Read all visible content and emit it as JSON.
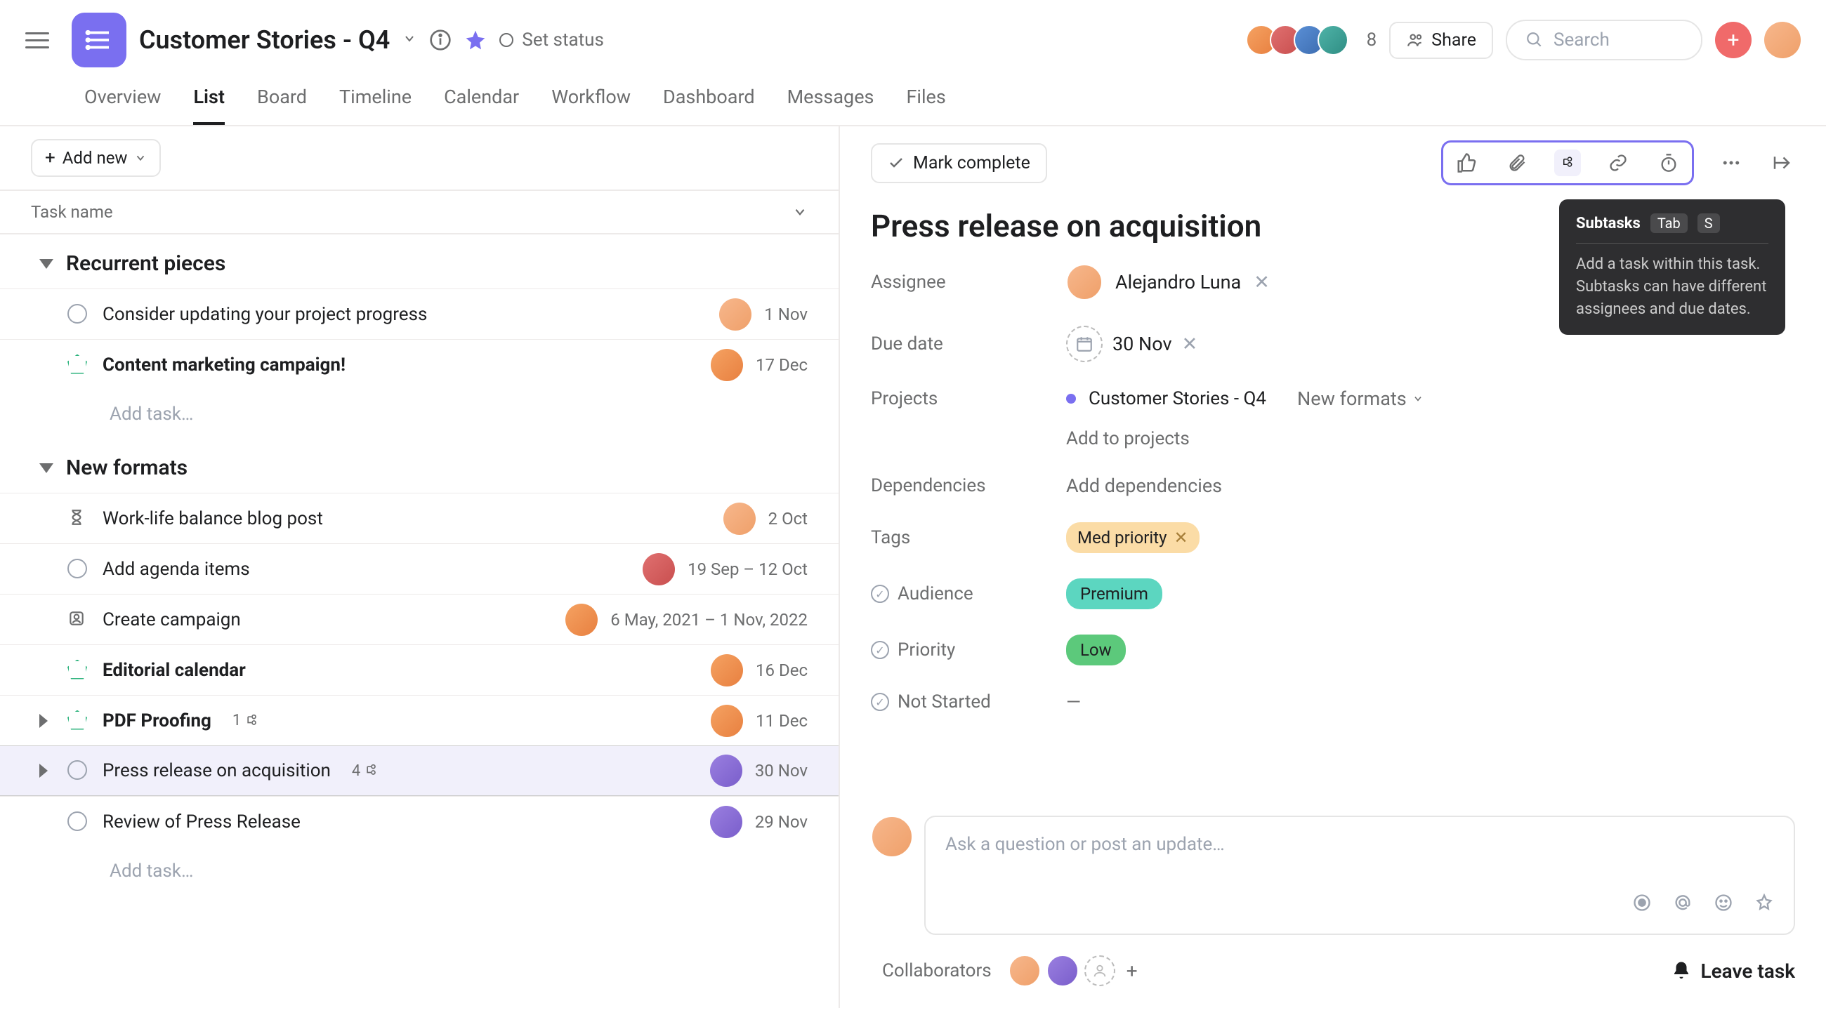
{
  "header": {
    "project_title": "Customer Stories - Q4",
    "set_status": "Set status",
    "member_count": "8",
    "share": "Share",
    "search_placeholder": "Search"
  },
  "tabs": [
    "Overview",
    "List",
    "Board",
    "Timeline",
    "Calendar",
    "Workflow",
    "Dashboard",
    "Messages",
    "Files"
  ],
  "active_tab": "List",
  "toolbar": {
    "add_new": "Add new"
  },
  "columns": {
    "task_name": "Task name"
  },
  "sections": [
    {
      "name": "Recurrent pieces",
      "tasks": [
        {
          "icon": "circle",
          "name": "Consider updating your project progress",
          "date": "1 Nov",
          "avatar": "av-peach"
        },
        {
          "icon": "pentagon",
          "name": "Content marketing campaign!",
          "bold": true,
          "date": "17 Dec",
          "avatar": "av-orange"
        }
      ],
      "add": "Add task…"
    },
    {
      "name": "New formats",
      "tasks": [
        {
          "icon": "hourglass",
          "name": "Work-life balance blog post",
          "date": "2 Oct",
          "avatar": "av-peach"
        },
        {
          "icon": "circle",
          "name": "Add agenda items",
          "date": "19 Sep – 12 Oct",
          "avatar": "av-red"
        },
        {
          "icon": "approval",
          "name": "Create campaign",
          "date": "6 May, 2021 – 1 Nov, 2022",
          "avatar": "av-orange"
        },
        {
          "icon": "pentagon",
          "name": "Editorial calendar",
          "bold": true,
          "date": "16 Dec",
          "avatar": "av-orange"
        },
        {
          "icon": "pentagon",
          "name": "PDF Proofing",
          "bold": true,
          "date": "11 Dec",
          "avatar": "av-orange",
          "expand": true,
          "subtasks": "1"
        },
        {
          "icon": "circle",
          "name": "Press release on acquisition",
          "date": "30 Nov",
          "avatar": "av-purple",
          "expand": true,
          "subtasks": "4",
          "selected": true
        },
        {
          "icon": "circle",
          "name": "Review of Press Release",
          "date": "29 Nov",
          "avatar": "av-purple"
        }
      ],
      "add": "Add task…"
    }
  ],
  "detail": {
    "mark_complete": "Mark complete",
    "title": "Press release on acquisition",
    "tooltip": {
      "title": "Subtasks",
      "key1": "Tab",
      "key2": "S",
      "body": "Add a task within this task. Subtasks can have different assignees and due dates."
    },
    "labels": {
      "assignee": "Assignee",
      "due": "Due date",
      "projects": "Projects",
      "add_to_projects": "Add to projects",
      "deps": "Dependencies",
      "add_deps": "Add dependencies",
      "tags": "Tags",
      "audience": "Audience",
      "priority": "Priority",
      "not_started": "Not Started"
    },
    "assignee_name": "Alejandro Luna",
    "due_date": "30 Nov",
    "project_name": "Customer Stories - Q4",
    "project_section": "New formats",
    "tag": "Med priority",
    "audience": "Premium",
    "priority": "Low",
    "not_started_value": "—",
    "comment_placeholder": "Ask a question or post an update…",
    "collaborators": "Collaborators",
    "leave_task": "Leave task"
  }
}
